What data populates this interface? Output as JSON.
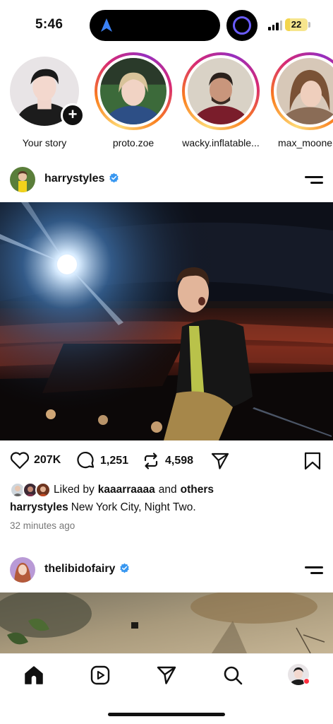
{
  "status_bar": {
    "time": "5:46",
    "battery_percent": "22",
    "battery_level": 0.22,
    "signal_bars": 3
  },
  "stories": [
    {
      "name": "Your story",
      "has_add_button": true,
      "seen": true,
      "plus": "+"
    },
    {
      "name": "proto.zoe",
      "seen": false
    },
    {
      "name": "wacky.inflatable...",
      "seen": false
    },
    {
      "name": "max_moone",
      "seen": false
    }
  ],
  "post1": {
    "username": "harrystyles",
    "verified": true,
    "likes_count": "207K",
    "comments_count": "1,251",
    "reposts_count": "4,598",
    "liked_by_prefix": "Liked by",
    "liked_by_user": "kaaarraaaa",
    "liked_by_and": "and",
    "liked_by_others": "others",
    "caption_user": "harrystyles",
    "caption_text": "New York City, Night Two.",
    "time_ago": "32 minutes ago"
  },
  "post2": {
    "username": "thelibidofairy",
    "verified": true
  },
  "bottom_nav": {
    "items": [
      "home-icon",
      "reels-icon",
      "send-icon",
      "search-icon",
      "profile-avatar"
    ],
    "active": "home-icon",
    "profile_notification": true
  },
  "colors": {
    "verified": "#3897f0",
    "story_ring": [
      "#feda75",
      "#fa7e1e",
      "#d62976",
      "#962fbf"
    ],
    "notification_dot": "#ff3040",
    "battery": "#f3d54e",
    "island_ring": "#6a5cff"
  }
}
